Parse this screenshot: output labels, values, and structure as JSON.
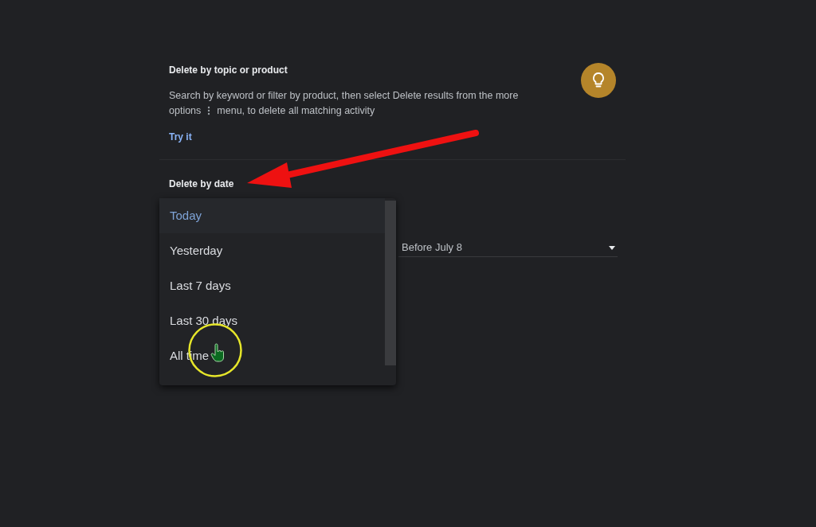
{
  "topic_section": {
    "title": "Delete by topic or product",
    "description": {
      "before_icon": "Search by keyword or filter by product, then select Delete results from the more options",
      "after_icon": "menu, to delete all matching activity"
    },
    "link": "Try it"
  },
  "date_section": {
    "title": "Delete by date",
    "range_menu": {
      "items": [
        {
          "label": "Today",
          "selected": true
        },
        {
          "label": "Yesterday",
          "selected": false
        },
        {
          "label": "Last 7 days",
          "selected": false
        },
        {
          "label": "Last 30 days",
          "selected": false
        },
        {
          "label": "All time",
          "selected": false
        }
      ]
    },
    "before_select": {
      "value": "Before July 8"
    }
  }
}
